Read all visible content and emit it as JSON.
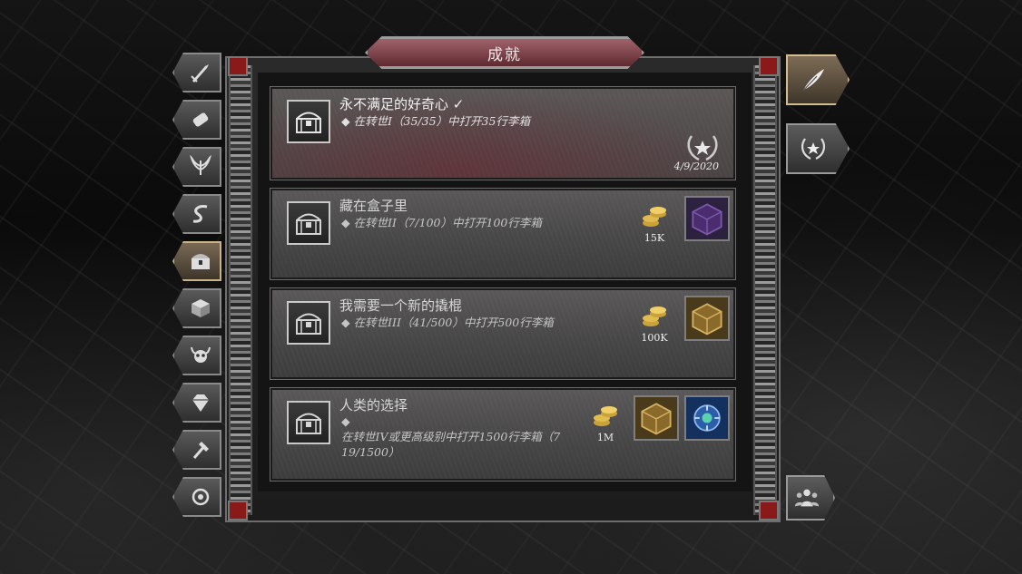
{
  "title": "成就",
  "left_tabs": [
    {
      "icon": "sword-icon",
      "active": false
    },
    {
      "icon": "scroll-icon",
      "active": false
    },
    {
      "icon": "wings-icon",
      "active": false
    },
    {
      "icon": "serpent-icon",
      "active": false
    },
    {
      "icon": "chest-icon",
      "active": true
    },
    {
      "icon": "blocks-icon",
      "active": false
    },
    {
      "icon": "horned-skull-icon",
      "active": false
    },
    {
      "icon": "gem-icon",
      "active": false
    },
    {
      "icon": "hammer-icon",
      "active": false
    },
    {
      "icon": "emblem-icon",
      "active": false
    }
  ],
  "right_tabs": [
    {
      "icon": "feather-icon",
      "active": true
    },
    {
      "icon": "laurel-star-icon",
      "active": false
    },
    {
      "icon": "group-icon",
      "active": false
    }
  ],
  "achievements": [
    {
      "title": "永不满足的好奇心 ✓",
      "desc": "◆ 在转世I（35/35）中打开35行李箱",
      "date": "4/9/2020",
      "completed": true
    },
    {
      "title": "藏在盒子里",
      "desc": "◆ 在转世II（7/100）中打开100行李箱",
      "gold": "15K",
      "reward": "purple-cube-icon"
    },
    {
      "title": "我需要一个新的撬棍",
      "desc": "◆ 在转世III（41/500）中打开500行李箱",
      "gold": "100K",
      "reward": "gold-cube-icon"
    },
    {
      "title": "人类的选择",
      "desc_line1": "◆",
      "desc_line2": "在转世IV或更高级别中打开1500行李箱（7",
      "desc_line3": "19/1500）",
      "gold": "1M",
      "reward": "gold-cube-icon",
      "reward2": "blue-orb-icon"
    }
  ],
  "colors": {
    "title_plate": "#8a4650",
    "active_tab": "#c9b48a",
    "purple": "#4b2c6e",
    "gold": "#c9a23a",
    "blue": "#2b5da8"
  }
}
